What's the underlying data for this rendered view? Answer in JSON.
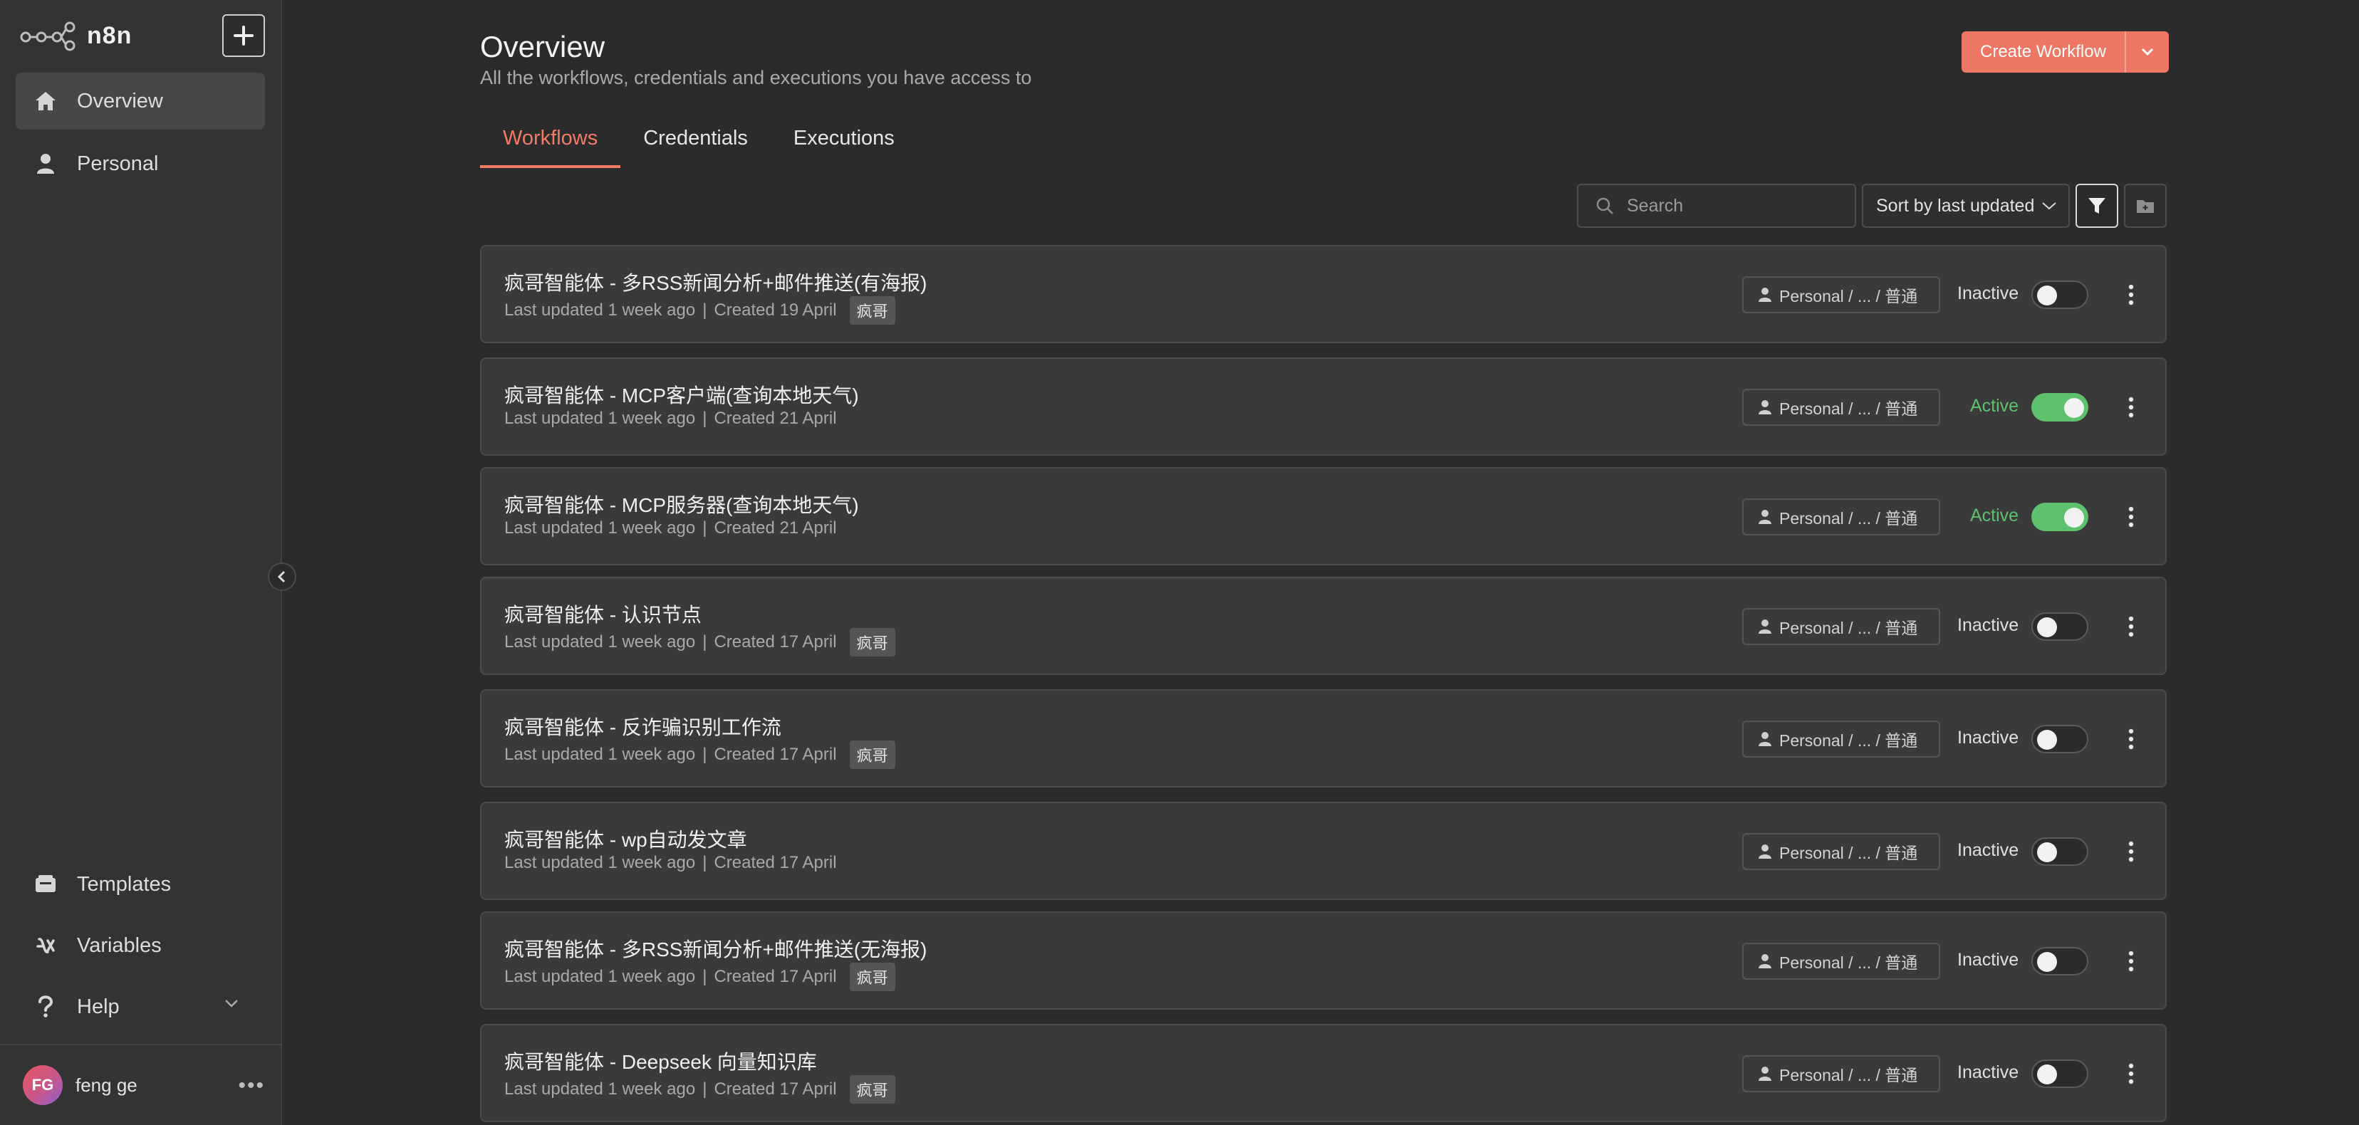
{
  "app": {
    "name": "n8n"
  },
  "sidebar": {
    "items": [
      {
        "label": "Overview",
        "icon": "home-icon",
        "active": true
      },
      {
        "label": "Personal",
        "icon": "user-icon",
        "active": false
      }
    ],
    "bottom_items": [
      {
        "label": "Templates",
        "icon": "templates-icon"
      },
      {
        "label": "Variables",
        "icon": "variables-icon"
      },
      {
        "label": "Help",
        "icon": "help-icon"
      }
    ],
    "user": {
      "initials": "FG",
      "name": "feng ge"
    }
  },
  "header": {
    "title": "Overview",
    "subtitle": "All the workflows, credentials and executions you have access to",
    "create_label": "Create Workflow"
  },
  "tabs": [
    {
      "label": "Workflows",
      "active": true
    },
    {
      "label": "Credentials",
      "active": false
    },
    {
      "label": "Executions",
      "active": false
    }
  ],
  "toolbar": {
    "search_placeholder": "Search",
    "sort_label": "Sort by last updated"
  },
  "colors": {
    "accent": "#ee7665",
    "active_green": "#5ec16e",
    "background": "#2b2b2b",
    "card": "#3a3a3a"
  },
  "workflows": [
    {
      "title": "疯哥智能体 - 多RSS新闻分析+邮件推送(有海报)",
      "updated": "Last updated 1 week ago",
      "created": "Created 19 April",
      "tag": "疯哥",
      "owner": "Personal / ... / 普通",
      "status": "Inactive",
      "active": false
    },
    {
      "title": "疯哥智能体 - MCP客户端(查询本地天气)",
      "updated": "Last updated 1 week ago",
      "created": "Created 21 April",
      "tag": "",
      "owner": "Personal / ... / 普通",
      "status": "Active",
      "active": true
    },
    {
      "title": "疯哥智能体 - MCP服务器(查询本地天气)",
      "updated": "Last updated 1 week ago",
      "created": "Created 21 April",
      "tag": "",
      "owner": "Personal / ... / 普通",
      "status": "Active",
      "active": true
    },
    {
      "title": "疯哥智能体 - 认识节点",
      "updated": "Last updated 1 week ago",
      "created": "Created 17 April",
      "tag": "疯哥",
      "owner": "Personal / ... / 普通",
      "status": "Inactive",
      "active": false
    },
    {
      "title": "疯哥智能体 - 反诈骗识别工作流",
      "updated": "Last updated 1 week ago",
      "created": "Created 17 April",
      "tag": "疯哥",
      "owner": "Personal / ... / 普通",
      "status": "Inactive",
      "active": false
    },
    {
      "title": "疯哥智能体 - wp自动发文章",
      "updated": "Last updated 1 week ago",
      "created": "Created 17 April",
      "tag": "",
      "owner": "Personal / ... / 普通",
      "status": "Inactive",
      "active": false
    },
    {
      "title": "疯哥智能体 - 多RSS新闻分析+邮件推送(无海报)",
      "updated": "Last updated 1 week ago",
      "created": "Created 17 April",
      "tag": "疯哥",
      "owner": "Personal / ... / 普通",
      "status": "Inactive",
      "active": false
    },
    {
      "title": "疯哥智能体 - Deepseek 向量知识库",
      "updated": "Last updated 1 week ago",
      "created": "Created 17 April",
      "tag": "疯哥",
      "owner": "Personal / ... / 普通",
      "status": "Inactive",
      "active": false
    }
  ]
}
